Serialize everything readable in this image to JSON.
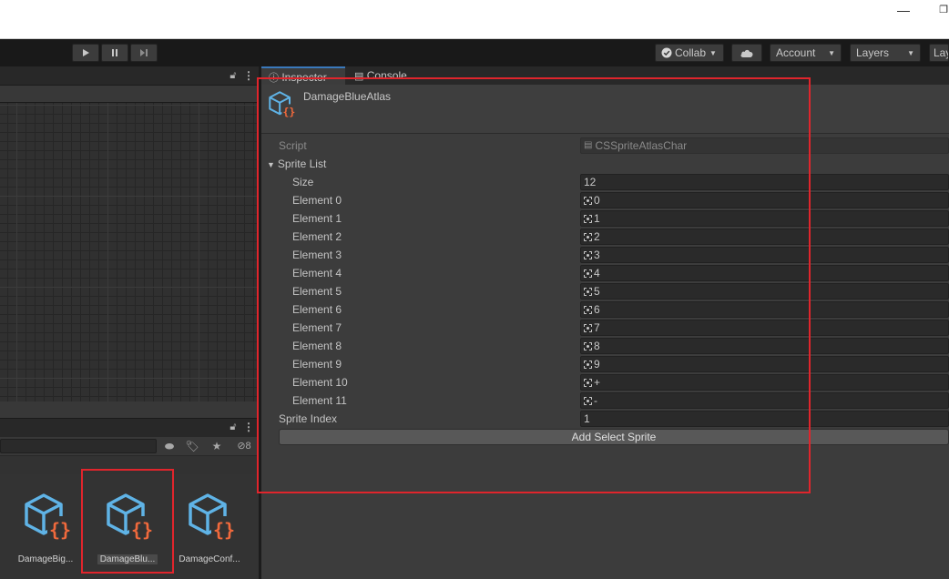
{
  "toolbar": {
    "collab_label": "Collab",
    "account_label": "Account",
    "layers_label": "Layers",
    "layout_label": "Lay"
  },
  "project": {
    "hidden_count": "8",
    "assets": [
      {
        "name": "DamageBig..."
      },
      {
        "name": "DamageBlu..."
      },
      {
        "name": "DamageConf..."
      }
    ]
  },
  "inspector": {
    "tabs": [
      {
        "label": "Inspector",
        "icon": "info-icon"
      },
      {
        "label": "Console",
        "icon": "console-icon"
      }
    ],
    "asset_title": "DamageBlueAtlas",
    "script_label": "Script",
    "script_value": "CSSpriteAtlasChar",
    "sprite_list_label": "Sprite List",
    "size_label": "Size",
    "size_value": "12",
    "elements": [
      {
        "label": "Element 0",
        "value": "0"
      },
      {
        "label": "Element 1",
        "value": "1"
      },
      {
        "label": "Element 2",
        "value": "2"
      },
      {
        "label": "Element 3",
        "value": "3"
      },
      {
        "label": "Element 4",
        "value": "4"
      },
      {
        "label": "Element 5",
        "value": "5"
      },
      {
        "label": "Element 6",
        "value": "6"
      },
      {
        "label": "Element 7",
        "value": "7"
      },
      {
        "label": "Element 8",
        "value": "8"
      },
      {
        "label": "Element 9",
        "value": "9"
      },
      {
        "label": "Element 10",
        "value": "+"
      },
      {
        "label": "Element 11",
        "value": "-"
      }
    ],
    "sprite_index_label": "Sprite Index",
    "sprite_index_value": "1",
    "add_button_label": "Add Select Sprite"
  },
  "colors": {
    "highlight": "#e0252c",
    "cube_blue": "#5fb3e6",
    "braces_orange": "#f0693c",
    "active_tab_accent": "#3a79bb"
  }
}
